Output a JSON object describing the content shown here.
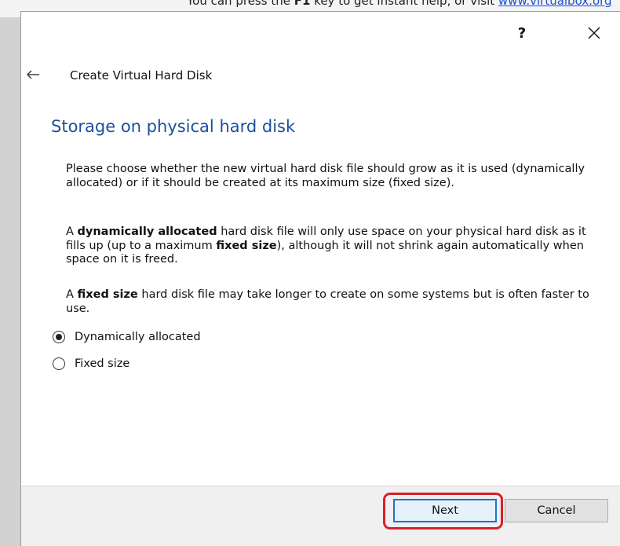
{
  "background_window": {
    "help_text_before": "You can press the ",
    "help_key": "F1",
    "help_text_after": " key to get instant help, or visit ",
    "help_link": "www.virtualbox.org"
  },
  "dialog": {
    "help_button": "?",
    "close_button_icon": "close-icon",
    "back_icon": "back-arrow-icon",
    "wizard_title": "Create Virtual Hard Disk",
    "heading": "Storage on physical hard disk",
    "paragraph1": "Please choose whether the new virtual hard disk file should grow as it is used (dynamically allocated) or if it should be created at its maximum size (fixed size).",
    "paragraph2": {
      "prefix": "A ",
      "bold1": "dynamically allocated",
      "middle": " hard disk file will only use space on your physical hard disk as it fills up (up to a maximum ",
      "bold2": "fixed size",
      "suffix": "), although it will not shrink again automatically when space on it is freed."
    },
    "paragraph3": {
      "prefix": "A ",
      "bold": "fixed size",
      "suffix": " hard disk file may take longer to create on some systems but is often faster to use."
    },
    "options": [
      {
        "label": "Dynamically allocated",
        "selected": true
      },
      {
        "label": "Fixed size",
        "selected": false
      }
    ],
    "buttons": {
      "next": "Next",
      "cancel": "Cancel"
    },
    "colors": {
      "heading": "#1c4f9c",
      "highlight": "#d6202b",
      "default_button_border": "#1a75d1"
    }
  }
}
